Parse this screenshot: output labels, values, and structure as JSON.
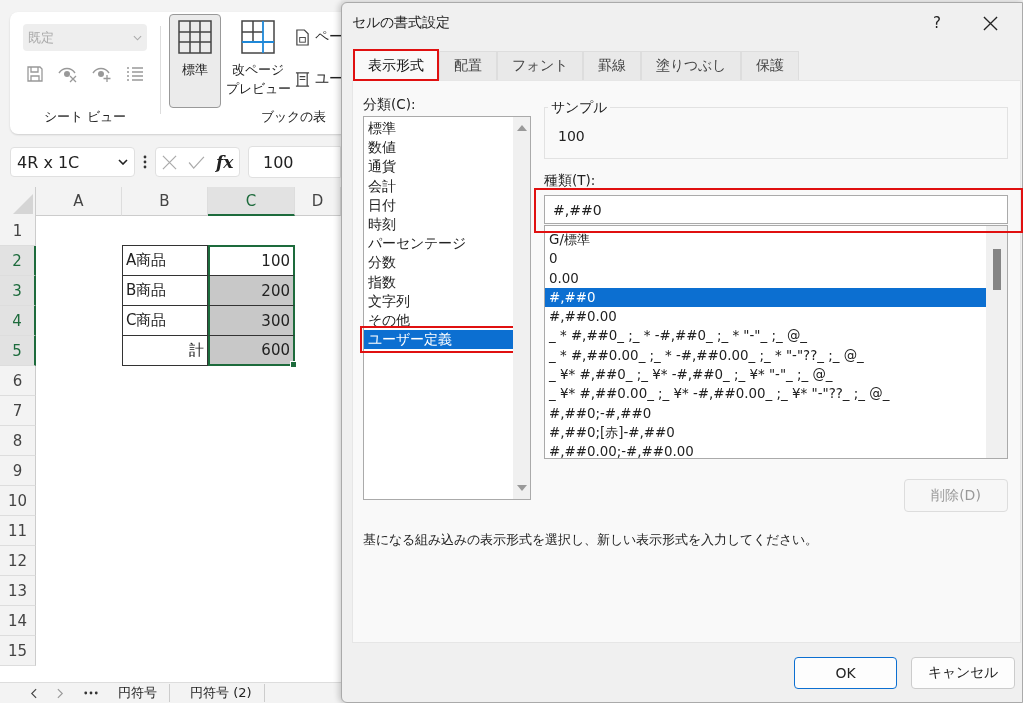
{
  "ribbon": {
    "style_dropdown": {
      "value": "既定",
      "disabled": true
    },
    "sheet_view_group": "シート ビュー",
    "view_buttons": [
      {
        "lines": [
          "標準"
        ],
        "selected": true,
        "kind": "normal"
      },
      {
        "lines": [
          "改ページ",
          "プレビュー"
        ],
        "selected": false,
        "kind": "pagebreak"
      }
    ],
    "small_buttons": [
      {
        "label": "ペー",
        "kind": "page"
      },
      {
        "label": "ユー",
        "kind": "custom"
      }
    ],
    "book_view_group": "ブックの表"
  },
  "formula_bar": {
    "name_box": "4R x 1C",
    "fx": "fx",
    "value": "100"
  },
  "sheet": {
    "columns": [
      {
        "label": "A",
        "selected": false
      },
      {
        "label": "B",
        "selected": false
      },
      {
        "label": "C",
        "selected": true
      },
      {
        "label": "D",
        "selected": false
      }
    ],
    "rows": [
      {
        "label": "1",
        "selected": false
      },
      {
        "label": "2",
        "selected": true
      },
      {
        "label": "3",
        "selected": true
      },
      {
        "label": "4",
        "selected": true
      },
      {
        "label": "5",
        "selected": true
      },
      {
        "label": "6",
        "selected": false
      },
      {
        "label": "7",
        "selected": false
      },
      {
        "label": "8",
        "selected": false
      },
      {
        "label": "9",
        "selected": false
      },
      {
        "label": "10",
        "selected": false
      },
      {
        "label": "11",
        "selected": false
      },
      {
        "label": "12",
        "selected": false
      },
      {
        "label": "13",
        "selected": false
      },
      {
        "label": "14",
        "selected": false
      },
      {
        "label": "15",
        "selected": false
      }
    ],
    "table": [
      {
        "label": "A商品",
        "kind": "item",
        "value": "100",
        "shaded": false
      },
      {
        "label": "B商品",
        "kind": "item",
        "value": "200",
        "shaded": true
      },
      {
        "label": "C商品",
        "kind": "item",
        "value": "300",
        "shaded": true
      },
      {
        "label": "計",
        "kind": "total",
        "value": "600",
        "shaded": true
      }
    ],
    "sheet_tabs": [
      "円符号",
      "円符号 (2)"
    ]
  },
  "dialog": {
    "title": "セルの書式設定",
    "help": "?",
    "tabs": [
      {
        "label": "表示形式",
        "selected": true,
        "highlighted": true
      },
      {
        "label": "配置",
        "selected": false,
        "highlighted": false
      },
      {
        "label": "フォント",
        "selected": false,
        "highlighted": false
      },
      {
        "label": "罫線",
        "selected": false,
        "highlighted": false
      },
      {
        "label": "塗りつぶし",
        "selected": false,
        "highlighted": false
      },
      {
        "label": "保護",
        "selected": false,
        "highlighted": false
      }
    ],
    "category_label": "分類(C):",
    "categories": [
      {
        "label": "標準",
        "selected": false,
        "highlighted": false
      },
      {
        "label": "数値",
        "selected": false,
        "highlighted": false
      },
      {
        "label": "通貨",
        "selected": false,
        "highlighted": false
      },
      {
        "label": "会計",
        "selected": false,
        "highlighted": false
      },
      {
        "label": "日付",
        "selected": false,
        "highlighted": false
      },
      {
        "label": "時刻",
        "selected": false,
        "highlighted": false
      },
      {
        "label": "パーセンテージ",
        "selected": false,
        "highlighted": false
      },
      {
        "label": "分数",
        "selected": false,
        "highlighted": false
      },
      {
        "label": "指数",
        "selected": false,
        "highlighted": false
      },
      {
        "label": "文字列",
        "selected": false,
        "highlighted": false
      },
      {
        "label": "その他",
        "selected": false,
        "highlighted": false
      },
      {
        "label": "ユーザー定義",
        "selected": true,
        "highlighted": true
      }
    ],
    "sample": {
      "label": "サンプル",
      "value": "100"
    },
    "type_label": "種類(T):",
    "type_input": {
      "value": "#,##0",
      "highlighted": true
    },
    "formats": [
      {
        "label": "G/標準",
        "selected": false
      },
      {
        "label": "0",
        "selected": false
      },
      {
        "label": "0.00",
        "selected": false
      },
      {
        "label": "#,##0",
        "selected": true
      },
      {
        "label": "#,##0.00",
        "selected": false
      },
      {
        "label": "_ * #,##0_ ;_ * -#,##0_ ;_ * \"-\"_ ;_ @_",
        "selected": false
      },
      {
        "label": "_ * #,##0.00_ ;_ * -#,##0.00_ ;_ * \"-\"??_ ;_ @_",
        "selected": false
      },
      {
        "label": "_ ¥* #,##0_ ;_ ¥* -#,##0_ ;_ ¥* \"-\"_ ;_ @_",
        "selected": false
      },
      {
        "label": "_ ¥* #,##0.00_ ;_ ¥* -#,##0.00_ ;_ ¥* \"-\"??_ ;_ @_",
        "selected": false
      },
      {
        "label": "#,##0;-#,##0",
        "selected": false
      },
      {
        "label": "#,##0;[赤]-#,##0",
        "selected": false
      },
      {
        "label": "#,##0.00;-#,##0.00",
        "selected": false
      }
    ],
    "delete_button": {
      "label": "削除(D)",
      "disabled": true
    },
    "description": "基になる組み込みの表示形式を選択し、新しい表示形式を入力してください。",
    "buttons": [
      {
        "label": "OK",
        "kind": "primary"
      },
      {
        "label": "キャンセル",
        "kind": "secondary"
      }
    ]
  }
}
